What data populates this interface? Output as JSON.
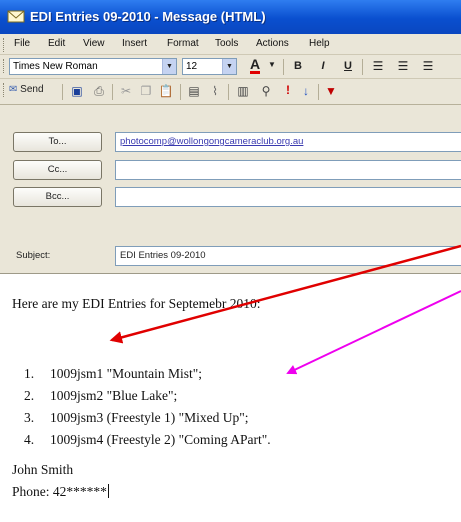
{
  "window": {
    "title": "EDI Entries 09-2010 - Message (HTML)"
  },
  "menu": [
    "File",
    "Edit",
    "View",
    "Insert",
    "Format",
    "Tools",
    "Actions",
    "Help"
  ],
  "format_bar": {
    "font": "Times New Roman",
    "size": "12",
    "bold": "B",
    "italic": "I",
    "underline": "U"
  },
  "standard_bar": {
    "send_label": "Send"
  },
  "header": {
    "to_label": "To...",
    "cc_label": "Cc...",
    "bcc_label": "Bcc...",
    "subject_label": "Subject:",
    "to_value": "photocomp@wollongongcameraclub.org.au",
    "cc_value": "",
    "bcc_value": "",
    "subject_value": "EDI Entries 09-2010"
  },
  "body": {
    "intro": "Here are my EDI Entries for Septemebr 2010:",
    "entries": [
      {
        "num": "1.",
        "text": "1009jsm1  \"Mountain Mist\";"
      },
      {
        "num": "2.",
        "text": "1009jsm2  \"Blue Lake\";"
      },
      {
        "num": "3.",
        "text": "1009jsm3 (Freestyle 1)  \"Mixed Up\";"
      },
      {
        "num": "4.",
        "text": "1009jsm4 (Freestyle 2)  \"Coming APart\"."
      }
    ],
    "signature_name": "John Smith",
    "signature_phone": "Phone: 42******"
  },
  "colors": {
    "titlebar": "#0a4fcf",
    "arrow_red": "#e00000",
    "arrow_magenta": "#ee00ee",
    "link": "#3a3ab0"
  }
}
